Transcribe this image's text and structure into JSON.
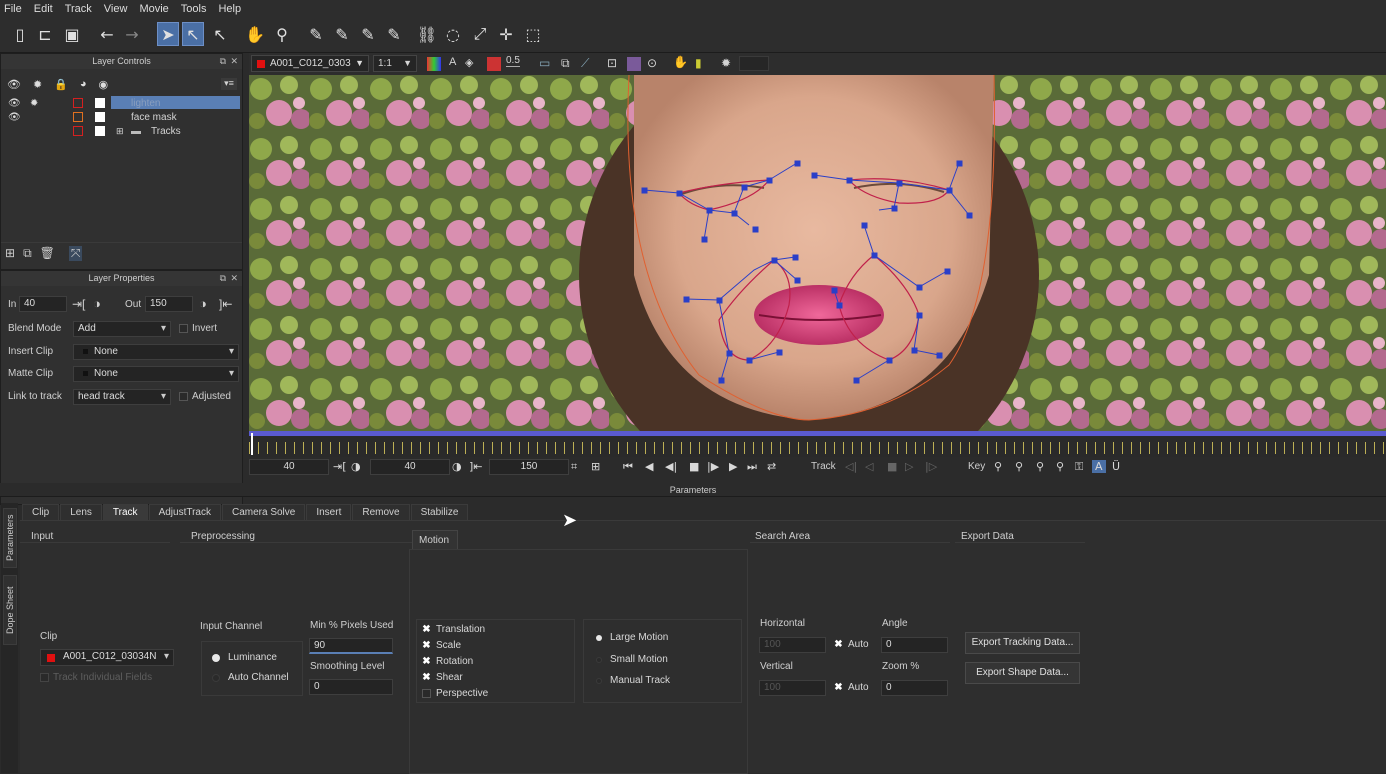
{
  "menu": [
    "File",
    "Edit",
    "Track",
    "View",
    "Movie",
    "Tools",
    "Help"
  ],
  "viewer_bar": {
    "clip": "A001_C012_0303",
    "zoom": "1:1",
    "opacity": "0.5"
  },
  "layer_controls": {
    "title": "Layer Controls",
    "layers": [
      {
        "name": "lighten",
        "color": "#d42020"
      },
      {
        "name": "face mask",
        "color": "#e07020"
      },
      {
        "name": "Tracks",
        "color": "#d42020"
      }
    ]
  },
  "layer_properties": {
    "title": "Layer Properties",
    "in_label": "In",
    "in_value": "40",
    "out_label": "Out",
    "out_value": "150",
    "blend_mode_label": "Blend Mode",
    "blend_mode_value": "Add",
    "invert_label": "Invert",
    "insert_clip_label": "Insert Clip",
    "insert_clip_value": "None",
    "matte_clip_label": "Matte Clip",
    "matte_clip_value": "None",
    "link_label": "Link to track",
    "link_value": "head track",
    "adjusted_label": "Adjusted"
  },
  "transport": {
    "frame_in": "40",
    "frame_cur": "40",
    "frame_out": "150",
    "track_label": "Track",
    "key_label": "Key"
  },
  "params_title": "Parameters",
  "tabs": [
    "Clip",
    "Lens",
    "Track",
    "AdjustTrack",
    "Camera Solve",
    "Insert",
    "Remove",
    "Stabilize"
  ],
  "active_tab": "Track",
  "side_tabs": [
    "Parameters",
    "Dope Sheet"
  ],
  "track": {
    "input_header": "Input",
    "preprocessing_header": "Preprocessing",
    "motion_header": "Motion",
    "search_area_header": "Search Area",
    "export_header": "Export Data",
    "clip_label": "Clip",
    "clip_value": "A001_C012_03034N",
    "track_fields": "Track Individual Fields",
    "input_channel_label": "Input Channel",
    "luminance": "Luminance",
    "auto_channel": "Auto Channel",
    "min_pixels_label": "Min % Pixels Used",
    "min_pixels_value": "90",
    "smoothing_label": "Smoothing Level",
    "smoothing_value": "0",
    "motion_types": [
      "Translation",
      "Scale",
      "Rotation",
      "Shear",
      "Perspective"
    ],
    "motion_modes": [
      "Large Motion",
      "Small Motion",
      "Manual Track"
    ],
    "horizontal_label": "Horizontal",
    "horizontal_value": "100",
    "vertical_label": "Vertical",
    "vertical_value": "100",
    "auto_label": "Auto",
    "angle_label": "Angle",
    "angle_value": "0",
    "zoom_label": "Zoom %",
    "zoom_value": "0",
    "export_tracking": "Export Tracking Data...",
    "export_shape": "Export Shape Data..."
  }
}
